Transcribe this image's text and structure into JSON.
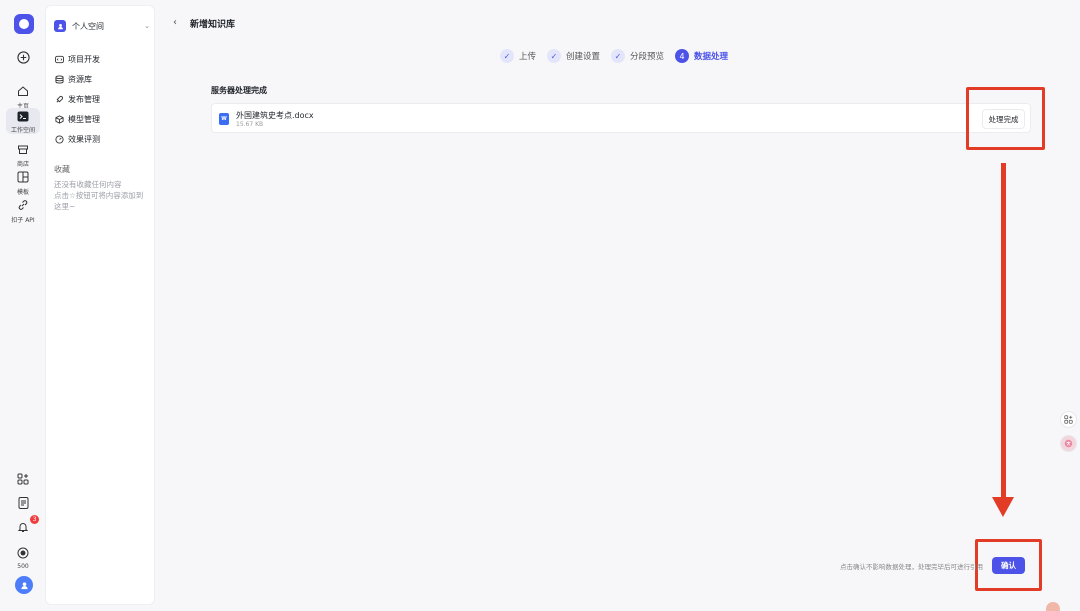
{
  "rail": {
    "home": "主页",
    "workspace": "工作空间",
    "store": "商店",
    "templates": "模板",
    "api": "扣子 API",
    "notification_count": "3",
    "points": "500"
  },
  "sidebar": {
    "space_name": "个人空间",
    "items": [
      {
        "label": "项目开发"
      },
      {
        "label": "资源库"
      },
      {
        "label": "发布管理"
      },
      {
        "label": "模型管理"
      },
      {
        "label": "效果评测"
      }
    ],
    "favorites_title": "收藏",
    "favorites_empty_1": "还没有收藏任何内容",
    "favorites_empty_2": "点击☆按钮可将内容添加到这里~"
  },
  "header": {
    "title": "新增知识库"
  },
  "steps": [
    {
      "label": "上传",
      "state": "done"
    },
    {
      "label": "创建设置",
      "state": "done"
    },
    {
      "label": "分段预览",
      "state": "done"
    },
    {
      "label": "数据处理",
      "state": "current",
      "number": "4"
    }
  ],
  "main": {
    "section_title": "服务器处理完成",
    "file": {
      "type_icon": "W",
      "name": "外国建筑史考点.docx",
      "size": "15.67 KB",
      "status": "处理完成"
    },
    "footer_note": "点击确认不影响数据处理，处理完毕后可进行引用",
    "confirm_label": "确认"
  },
  "colors": {
    "accent": "#4d53e8",
    "annotation": "#e23b26"
  }
}
